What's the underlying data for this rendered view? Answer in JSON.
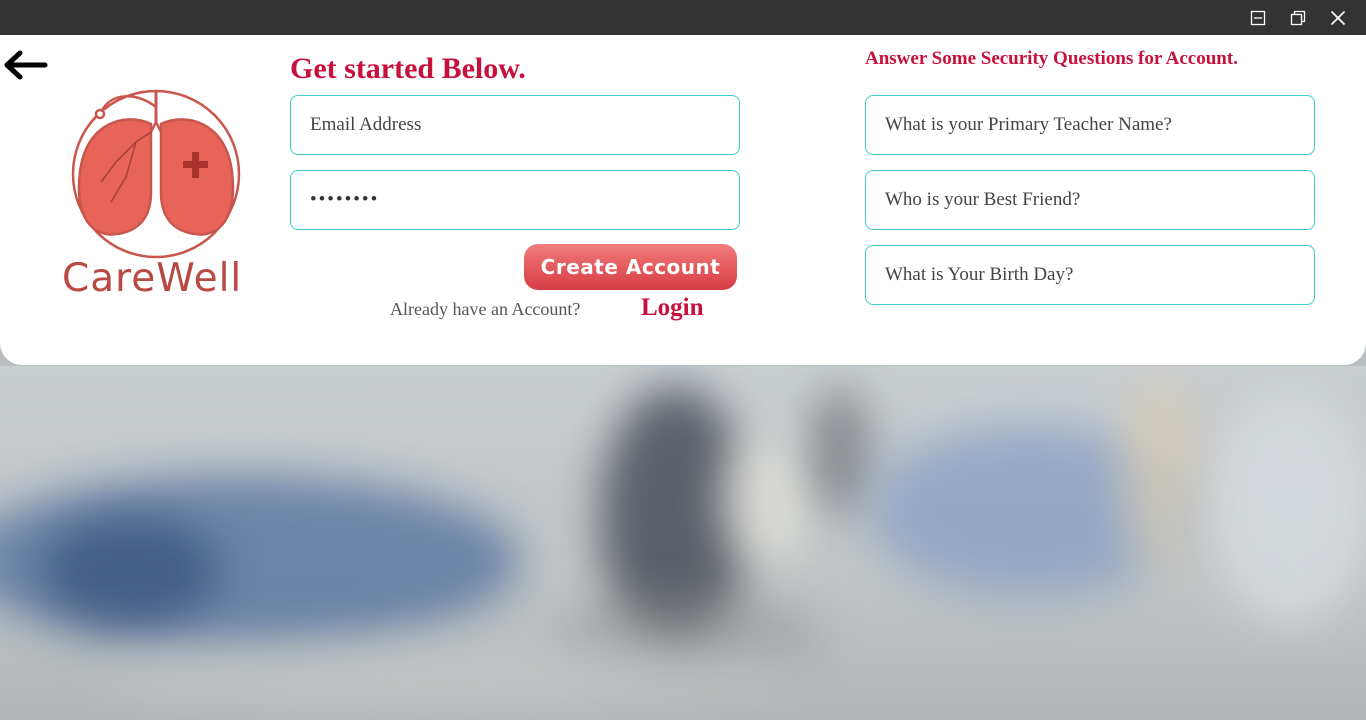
{
  "window": {
    "controls": [
      "minimize-icon",
      "restore-icon",
      "close-icon"
    ]
  },
  "nav": {
    "back_icon": "arrow-left-icon"
  },
  "brand": {
    "name": "CareWell",
    "logo_icon": "lungs-medical-icon",
    "color": "#b84a43"
  },
  "form": {
    "heading": "Get started Below.",
    "email": {
      "placeholder": "Email Address",
      "value": ""
    },
    "password": {
      "value": "••••••••"
    },
    "create_button": "Create Account",
    "already_text": "Already have an Account?",
    "login_link": "Login"
  },
  "security": {
    "heading": "Answer Some Security Questions for Account.",
    "questions": [
      {
        "placeholder": "What is your Primary Teacher Name?"
      },
      {
        "placeholder": "Who is your Best Friend?"
      },
      {
        "placeholder": "What is Your Birth Day?"
      }
    ]
  },
  "colors": {
    "accent": "#c8103c",
    "field_border": "#3ccfd1",
    "button": "#e45a5d",
    "titlebar": "#333333"
  }
}
